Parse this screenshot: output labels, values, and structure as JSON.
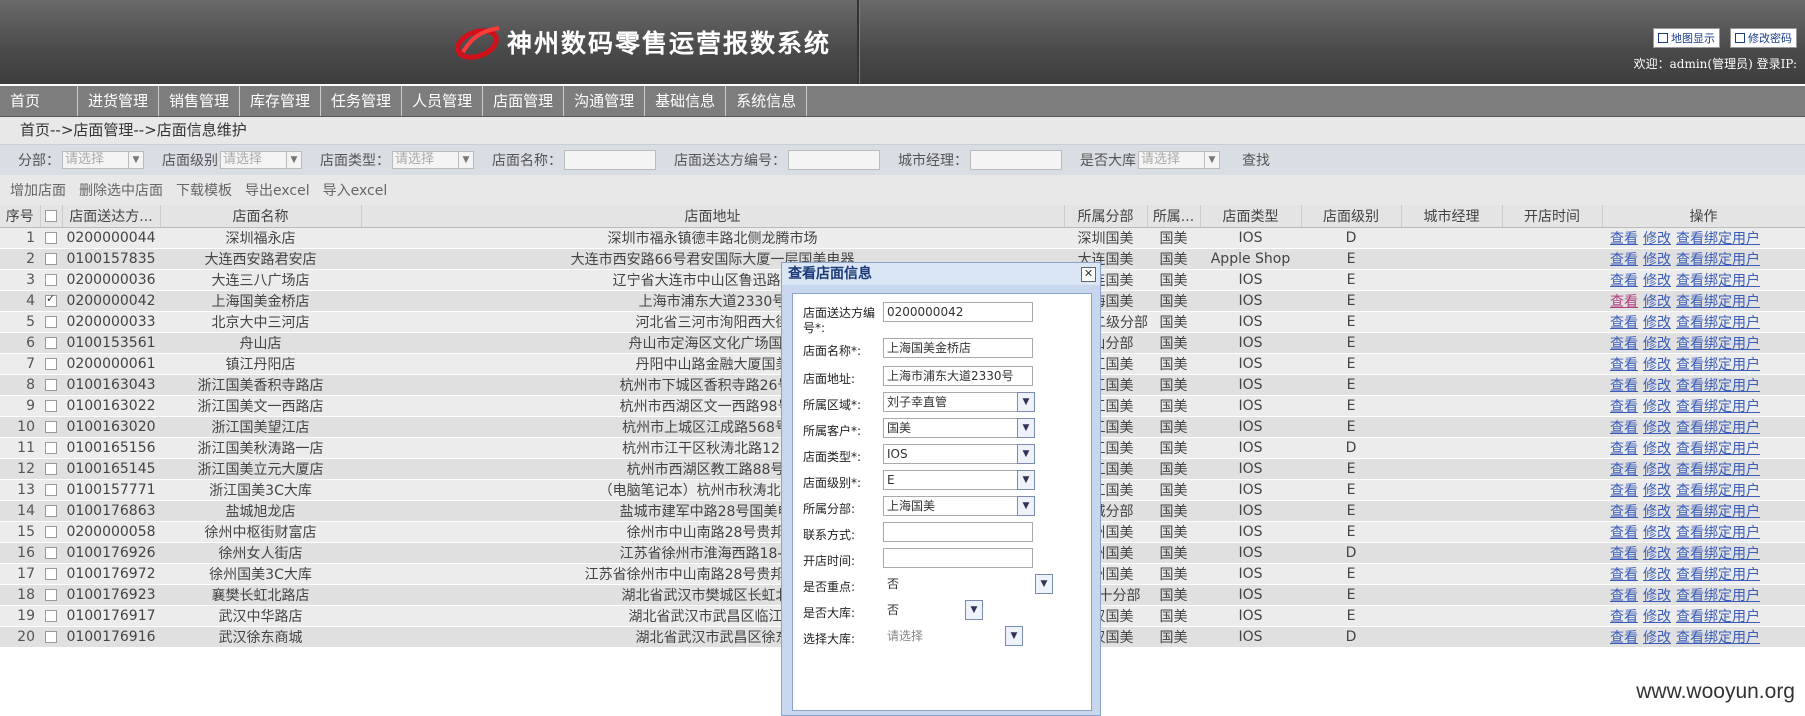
{
  "header": {
    "title": "神州数码零售运营报数系统",
    "map_button": "地图显示",
    "password_button": "修改密码",
    "welcome": "欢迎：admin(管理员) 登录IP:"
  },
  "nav": {
    "items": [
      "首页",
      "进货管理",
      "销售管理",
      "库存管理",
      "任务管理",
      "人员管理",
      "店面管理",
      "沟通管理",
      "基础信息",
      "系统信息"
    ]
  },
  "breadcrumb": "首页-->店面管理-->店面信息维护",
  "filters": {
    "branch_label": "分部：",
    "branch_value": "请选择",
    "level_label": "店面级别",
    "level_value": "请选择",
    "type_label": "店面类型：",
    "type_value": "请选择",
    "name_label": "店面名称：",
    "code_label": "店面送达方编号：",
    "manager_label": "城市经理：",
    "warehouse_label": "是否大库",
    "warehouse_value": "请选择",
    "search": "查找"
  },
  "toolbar": {
    "add": "增加店面",
    "delete": "删除选中店面",
    "download": "下载模板",
    "export": "导出excel",
    "import": "导入excel"
  },
  "table": {
    "headers": [
      "序号",
      "",
      "店面送达方...",
      "店面名称",
      "店面地址",
      "所属分部",
      "所属...",
      "店面类型",
      "店面级别",
      "城市经理",
      "开店时间",
      "操作"
    ],
    "ops": [
      "查看",
      "修改",
      "查看绑定用户"
    ],
    "rows": [
      [
        "1",
        "0200000044",
        "深圳福永店",
        "深圳市福永镇德丰路北侧龙腾市场",
        "深圳国美",
        "国美",
        "IOS",
        "D"
      ],
      [
        "2",
        "0100157835",
        "大连西安路君安店",
        "大连市西安路66号君安国际大厦一层国美电器",
        "大连国美",
        "国美",
        "Apple Shop",
        "E"
      ],
      [
        "3",
        "0200000036",
        "大连三八广场店",
        "辽宁省大连市中山区鲁迅路29-5",
        "大连国美",
        "国美",
        "IOS",
        "E"
      ],
      [
        "4",
        "0200000042",
        "上海国美金桥店",
        "上海市浦东大道2330号",
        "上海国美",
        "国美",
        "IOS",
        "E"
      ],
      [
        "5",
        "0200000033",
        "北京大中三河店",
        "河北省三河市洵阳西大街",
        "大中二级分部",
        "国美",
        "IOS",
        "E"
      ],
      [
        "6",
        "0100153561",
        "舟山店",
        "舟山市定海区文化广场国美",
        "舟山分部",
        "国美",
        "IOS",
        "E"
      ],
      [
        "7",
        "0200000061",
        "镇江丹阳店",
        "丹阳中山路金融大厦国美",
        "镇江国美",
        "国美",
        "IOS",
        "E"
      ],
      [
        "8",
        "0100163043",
        "浙江国美香积寺路店",
        "杭州市下城区香积寺路26号国",
        "浙江国美",
        "国美",
        "IOS",
        "E"
      ],
      [
        "9",
        "0100163022",
        "浙江国美文一西路店",
        "杭州市西湖区文一西路98号国",
        "浙江国美",
        "国美",
        "IOS",
        "E"
      ],
      [
        "10",
        "0100163020",
        "浙江国美望江店",
        "杭州市上城区江成路568号国",
        "浙江国美",
        "国美",
        "IOS",
        "E"
      ],
      [
        "11",
        "0100165156",
        "浙江国美秋涛路一店",
        "杭州市江干区秋涛北路128号",
        "浙江国美",
        "国美",
        "IOS",
        "D"
      ],
      [
        "12",
        "0100165145",
        "浙江国美立元大厦店",
        "杭州市西湖区教工路88号国",
        "浙江国美",
        "国美",
        "IOS",
        "E"
      ],
      [
        "13",
        "0100157771",
        "浙江国美3C大库",
        "（电脑笔记本）杭州市秋涛北路81号",
        "浙江国美",
        "国美",
        "IOS",
        "E"
      ],
      [
        "14",
        "0100176863",
        "盐城旭龙店",
        "盐城市建军中路28号国美电器",
        "盐城分部",
        "国美",
        "IOS",
        "E"
      ],
      [
        "15",
        "0200000058",
        "徐州中枢街财富店",
        "徐州市中山南路28号贵邦财",
        "徐州国美",
        "国美",
        "IOS",
        "E"
      ],
      [
        "16",
        "0100176926",
        "徐州女人街店",
        "江苏省徐州市淮海西路18-1号",
        "徐州国美",
        "国美",
        "IOS",
        "D"
      ],
      [
        "17",
        "0100176972",
        "徐州国美3C大库",
        "江苏省徐州市中山南路28号贵邦财富广场",
        "徐州国美",
        "国美",
        "IOS",
        "E"
      ],
      [
        "18",
        "0100176923",
        "襄樊长虹北路店",
        "湖北省武汉市樊城区长虹北路",
        "湖北十分部",
        "国美",
        "IOS",
        "E"
      ],
      [
        "19",
        "0100176917",
        "武汉中华路店",
        "湖北省武汉市武昌区临江大",
        "武汉国美",
        "国美",
        "IOS",
        "E"
      ],
      [
        "20",
        "0100176916",
        "武汉徐东商城",
        "湖北省武汉市武昌区徐东",
        "武汉国美",
        "国美",
        "IOS",
        "D"
      ]
    ],
    "checked_row": 4
  },
  "dialog": {
    "title": "查看店面信息",
    "code_label_1": "店面送达方编",
    "code_label_2": "号*:",
    "code_value": "0200000042",
    "name_label": "店面名称*:",
    "name_value": "上海国美金桥店",
    "address_label": "店面地址:",
    "address_value": "上海市浦东大道2330号",
    "region_label": "所属区域*:",
    "region_value": "刘子幸直管",
    "customer_label": "所属客户*:",
    "customer_value": "国美",
    "type_label": "店面类型*:",
    "type_value": "IOS",
    "level_label": "店面级别*:",
    "level_value": "E",
    "branch_label": "所属分部:",
    "branch_value": "上海国美",
    "contact_label": "联系方式:",
    "contact_value": "",
    "open_label": "开店时间:",
    "open_value": "",
    "key_label": "是否重点:",
    "key_value": "否",
    "warehouse_label": "是否大库:",
    "warehouse_value": "否",
    "select_label": "选择大库:",
    "select_value": "请选择"
  },
  "watermark": "www.wooyun.org"
}
